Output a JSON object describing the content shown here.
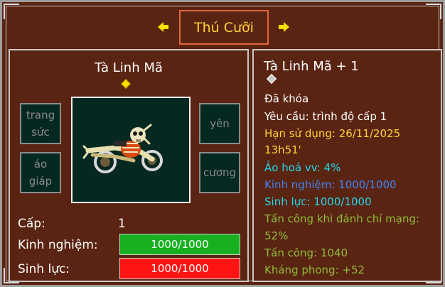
{
  "window": {
    "title": "Thú Cưỡi"
  },
  "mount": {
    "name": "Tà Linh Mã",
    "slots": {
      "top_left": "trang sức",
      "bottom_left": "áo giáp",
      "top_right": "yên",
      "bottom_right": "cương"
    },
    "stats": {
      "level_label": "Cấp:",
      "level_value": "1",
      "exp_label": "Kinh nghiệm:",
      "exp_value": "1000/1000",
      "exp_fill": 1.0,
      "hp_label": "Sinh lực:",
      "hp_value": "1000/1000",
      "hp_fill": 1.0
    }
  },
  "detail": {
    "title": "Tà Linh Mã + 1",
    "lines": [
      {
        "text": "Đã khóa",
        "color": "#ffffff"
      },
      {
        "text": "Yêu cầu: trình độ cấp 1",
        "color": "#ffffff"
      },
      {
        "text": "Hạn sử dụng: 26/11/2025",
        "color": "#ffd23a"
      },
      {
        "text": "13h51'",
        "color": "#ffd23a"
      },
      {
        "text": "Ảo hoá vv: 4%",
        "color": "#22d8e8"
      },
      {
        "text": "Kinh nghiệm: 1000/1000",
        "color": "#3f86f0"
      },
      {
        "text": "Sinh lực: 1000/1000",
        "color": "#22d8e8"
      },
      {
        "text": "Tấn công khi đánh chí mạng:",
        "color": "#8fbc3a"
      },
      {
        "text": "52%",
        "color": "#8fbc3a"
      },
      {
        "text": "Tấn công: 1040",
        "color": "#8fbc3a"
      },
      {
        "text": "Kháng phong:  +52",
        "color": "#8fbc3a"
      }
    ]
  },
  "colors": {
    "title_text": "#ffd23a",
    "accent_border": "#e0683a",
    "exp_bar": "#18b020",
    "hp_bar": "#ff1414"
  },
  "icons": {
    "prev": "arrow-left-icon",
    "next": "arrow-right-icon",
    "mount_marker": "yellow-diamond-icon",
    "detail_marker": "gray-diamond-icon"
  }
}
